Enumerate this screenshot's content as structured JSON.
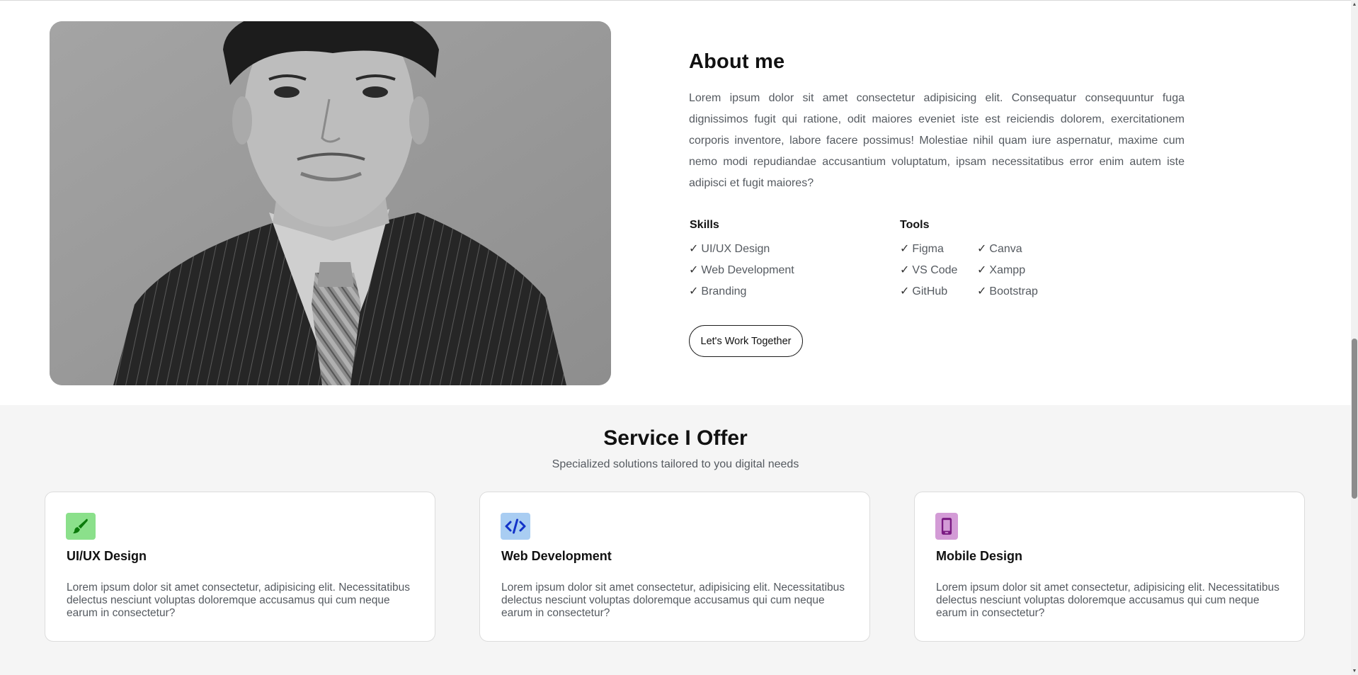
{
  "about": {
    "title": "About me",
    "text": "Lorem ipsum dolor sit amet consectetur adipisicing elit. Consequatur consequuntur fuga dignissimos fugit qui ratione, odit maiores eveniet iste est reiciendis dolorem, exercitationem corporis inventore, labore facere possimus! Molestiae nihil quam iure aspernatur, maxime cum nemo modi repudiandae accusantium voluptatum, ipsam necessitatibus error enim autem iste adipisci et fugit maiores?",
    "skills": {
      "title": "Skills",
      "items": [
        "UI/UX Design",
        "Web Development",
        "Branding"
      ]
    },
    "tools": {
      "title": "Tools",
      "col1": [
        "Figma",
        "VS Code",
        "GitHub"
      ],
      "col2": [
        "Canva",
        "Xampp",
        "Bootstrap"
      ]
    },
    "check": "✓",
    "button": "Let's Work Together"
  },
  "services": {
    "title": "Service I Offer",
    "subtitle": "Specialized solutions tailored to you digital needs",
    "cards": [
      {
        "title": "UI/UX Design",
        "text": "Lorem ipsum dolor sit amet consectetur, adipisicing elit. Necessitatibus delectus nesciunt voluptas doloremque accusamus qui cum neque earum in consectetur?",
        "icon": "paintbrush-icon",
        "icon_bg": "#8be08b",
        "icon_color": "#0a7a0a"
      },
      {
        "title": "Web Development",
        "text": "Lorem ipsum dolor sit amet consectetur, adipisicing elit. Necessitatibus delectus nesciunt voluptas doloremque accusamus qui cum neque earum in consectetur?",
        "icon": "code-icon",
        "icon_bg": "#a9cdf2",
        "icon_color": "#1232c8"
      },
      {
        "title": "Mobile Design",
        "text": "Lorem ipsum dolor sit amet consectetur, adipisicing elit. Necessitatibus delectus nesciunt voluptas doloremque accusamus qui cum neque earum in consectetur?",
        "icon": "mobile-phone-icon",
        "icon_bg": "#d39bd6",
        "icon_color": "#7a1a82"
      }
    ]
  }
}
